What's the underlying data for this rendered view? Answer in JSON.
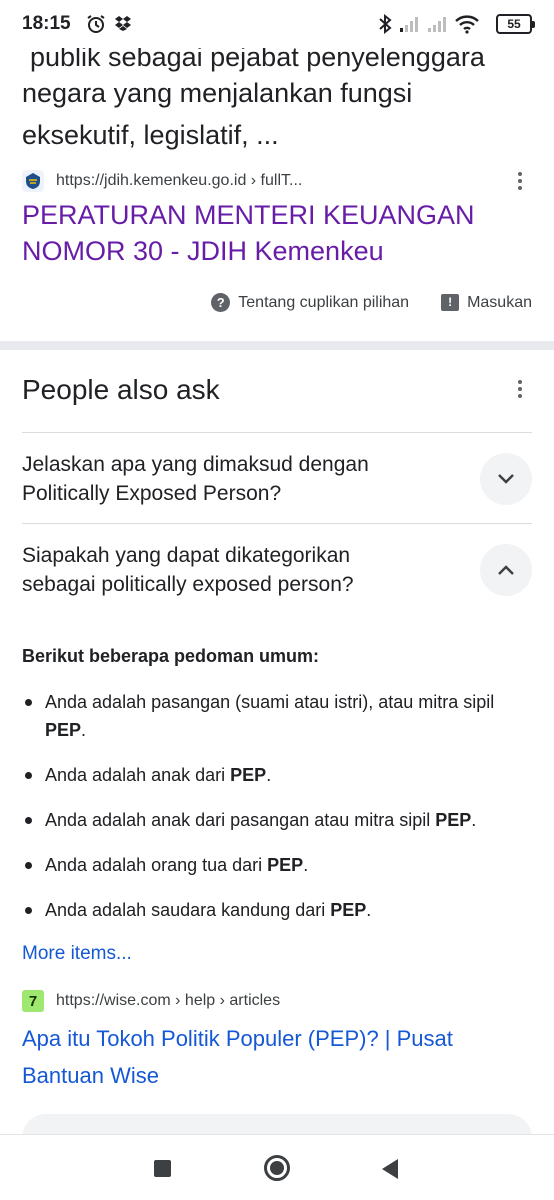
{
  "status_bar": {
    "time": "18:15",
    "battery": "55",
    "icons": [
      "alarm-icon",
      "dropbox-icon",
      "bluetooth-icon",
      "signal-icon",
      "signal-icon",
      "wifi-icon",
      "battery-icon"
    ]
  },
  "snippet": {
    "line1_partial": "publik sebagai pejabat penyelenggara",
    "line2": "negara yang menjalankan fungsi",
    "line3": "eksekutif, legislatif, ..."
  },
  "result1": {
    "url": "https://jdih.kemenkeu.go.id › fullT...",
    "title_line1": "PERATURAN MENTERI KEUANGAN",
    "title_line2": "NOMOR 30 - JDIH Kemenkeu"
  },
  "feedback": {
    "about_label": "Tentang cuplikan pilihan",
    "feedback_label": "Masukan"
  },
  "paa": {
    "title": "People also ask",
    "questions": [
      {
        "line1": "Jelaskan apa yang dimaksud dengan",
        "line2": "Politically Exposed Person?",
        "state": "collapsed"
      },
      {
        "line1": "Siapakah yang dapat dikategorikan",
        "line2": "sebagai politically exposed person?",
        "state": "expanded"
      }
    ]
  },
  "answer": {
    "heading": "Berikut beberapa pedoman umum:",
    "items": [
      {
        "text": "Anda adalah pasangan (suami atau istri), atau mitra sipil ",
        "bold": "PEP",
        "end": "."
      },
      {
        "text": "Anda adalah anak dari ",
        "bold": "PEP",
        "end": "."
      },
      {
        "text": "Anda adalah anak dari pasangan atau mitra sipil ",
        "bold": "PEP",
        "end": "."
      },
      {
        "text": "Anda adalah orang tua dari ",
        "bold": "PEP",
        "end": "."
      },
      {
        "text": "Anda adalah saudara kandung dari ",
        "bold": "PEP",
        "end": "."
      }
    ],
    "more_items": "More items..."
  },
  "result2": {
    "favicon_letter": "7",
    "url": "https://wise.com › help › articles",
    "title_line1": "Apa itu Tokoh Politik Populer (PEP)? | Pusat",
    "title_line2": "Bantuan Wise"
  },
  "colors": {
    "visited_link": "#681da8",
    "link": "#1558d6",
    "text": "#202124",
    "wise_green": "#9fe870"
  }
}
